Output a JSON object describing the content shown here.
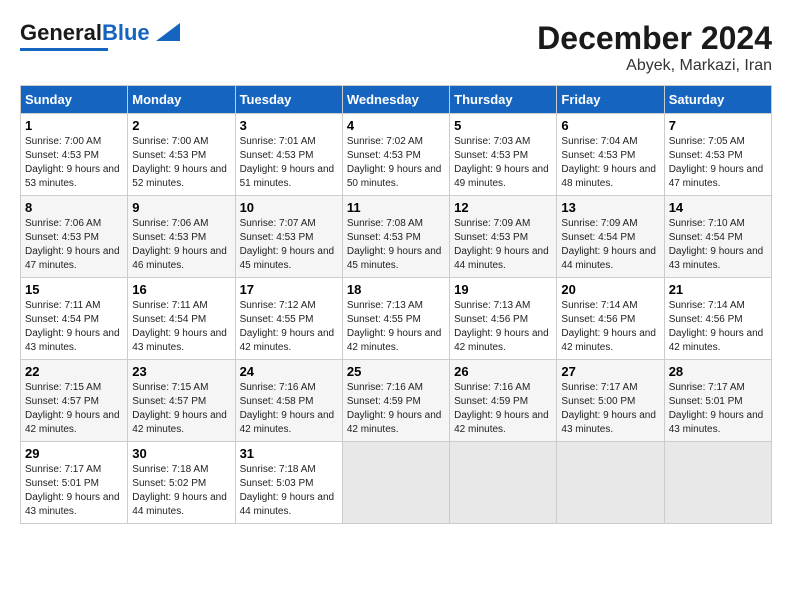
{
  "header": {
    "logo_general": "General",
    "logo_blue": "Blue",
    "month_title": "December 2024",
    "location": "Abyek, Markazi, Iran"
  },
  "calendar": {
    "days_of_week": [
      "Sunday",
      "Monday",
      "Tuesday",
      "Wednesday",
      "Thursday",
      "Friday",
      "Saturday"
    ],
    "weeks": [
      [
        {
          "day": "",
          "empty": true
        },
        {
          "day": "",
          "empty": true
        },
        {
          "day": "",
          "empty": true
        },
        {
          "day": "",
          "empty": true
        },
        {
          "day": "",
          "empty": true
        },
        {
          "day": "",
          "empty": true
        },
        {
          "day": "",
          "empty": true
        }
      ]
    ],
    "cells": [
      {
        "num": "1",
        "sunrise": "7:00 AM",
        "sunset": "4:53 PM",
        "daylight": "9 hours and 53 minutes."
      },
      {
        "num": "2",
        "sunrise": "7:00 AM",
        "sunset": "4:53 PM",
        "daylight": "9 hours and 52 minutes."
      },
      {
        "num": "3",
        "sunrise": "7:01 AM",
        "sunset": "4:53 PM",
        "daylight": "9 hours and 51 minutes."
      },
      {
        "num": "4",
        "sunrise": "7:02 AM",
        "sunset": "4:53 PM",
        "daylight": "9 hours and 50 minutes."
      },
      {
        "num": "5",
        "sunrise": "7:03 AM",
        "sunset": "4:53 PM",
        "daylight": "9 hours and 49 minutes."
      },
      {
        "num": "6",
        "sunrise": "7:04 AM",
        "sunset": "4:53 PM",
        "daylight": "9 hours and 48 minutes."
      },
      {
        "num": "7",
        "sunrise": "7:05 AM",
        "sunset": "4:53 PM",
        "daylight": "9 hours and 47 minutes."
      },
      {
        "num": "8",
        "sunrise": "7:06 AM",
        "sunset": "4:53 PM",
        "daylight": "9 hours and 47 minutes."
      },
      {
        "num": "9",
        "sunrise": "7:06 AM",
        "sunset": "4:53 PM",
        "daylight": "9 hours and 46 minutes."
      },
      {
        "num": "10",
        "sunrise": "7:07 AM",
        "sunset": "4:53 PM",
        "daylight": "9 hours and 45 minutes."
      },
      {
        "num": "11",
        "sunrise": "7:08 AM",
        "sunset": "4:53 PM",
        "daylight": "9 hours and 45 minutes."
      },
      {
        "num": "12",
        "sunrise": "7:09 AM",
        "sunset": "4:53 PM",
        "daylight": "9 hours and 44 minutes."
      },
      {
        "num": "13",
        "sunrise": "7:09 AM",
        "sunset": "4:54 PM",
        "daylight": "9 hours and 44 minutes."
      },
      {
        "num": "14",
        "sunrise": "7:10 AM",
        "sunset": "4:54 PM",
        "daylight": "9 hours and 43 minutes."
      },
      {
        "num": "15",
        "sunrise": "7:11 AM",
        "sunset": "4:54 PM",
        "daylight": "9 hours and 43 minutes."
      },
      {
        "num": "16",
        "sunrise": "7:11 AM",
        "sunset": "4:54 PM",
        "daylight": "9 hours and 43 minutes."
      },
      {
        "num": "17",
        "sunrise": "7:12 AM",
        "sunset": "4:55 PM",
        "daylight": "9 hours and 42 minutes."
      },
      {
        "num": "18",
        "sunrise": "7:13 AM",
        "sunset": "4:55 PM",
        "daylight": "9 hours and 42 minutes."
      },
      {
        "num": "19",
        "sunrise": "7:13 AM",
        "sunset": "4:56 PM",
        "daylight": "9 hours and 42 minutes."
      },
      {
        "num": "20",
        "sunrise": "7:14 AM",
        "sunset": "4:56 PM",
        "daylight": "9 hours and 42 minutes."
      },
      {
        "num": "21",
        "sunrise": "7:14 AM",
        "sunset": "4:56 PM",
        "daylight": "9 hours and 42 minutes."
      },
      {
        "num": "22",
        "sunrise": "7:15 AM",
        "sunset": "4:57 PM",
        "daylight": "9 hours and 42 minutes."
      },
      {
        "num": "23",
        "sunrise": "7:15 AM",
        "sunset": "4:57 PM",
        "daylight": "9 hours and 42 minutes."
      },
      {
        "num": "24",
        "sunrise": "7:16 AM",
        "sunset": "4:58 PM",
        "daylight": "9 hours and 42 minutes."
      },
      {
        "num": "25",
        "sunrise": "7:16 AM",
        "sunset": "4:59 PM",
        "daylight": "9 hours and 42 minutes."
      },
      {
        "num": "26",
        "sunrise": "7:16 AM",
        "sunset": "4:59 PM",
        "daylight": "9 hours and 42 minutes."
      },
      {
        "num": "27",
        "sunrise": "7:17 AM",
        "sunset": "5:00 PM",
        "daylight": "9 hours and 43 minutes."
      },
      {
        "num": "28",
        "sunrise": "7:17 AM",
        "sunset": "5:01 PM",
        "daylight": "9 hours and 43 minutes."
      },
      {
        "num": "29",
        "sunrise": "7:17 AM",
        "sunset": "5:01 PM",
        "daylight": "9 hours and 43 minutes."
      },
      {
        "num": "30",
        "sunrise": "7:18 AM",
        "sunset": "5:02 PM",
        "daylight": "9 hours and 44 minutes."
      },
      {
        "num": "31",
        "sunrise": "7:18 AM",
        "sunset": "5:03 PM",
        "daylight": "9 hours and 44 minutes."
      }
    ],
    "labels": {
      "sunrise": "Sunrise:",
      "sunset": "Sunset:",
      "daylight": "Daylight:"
    }
  }
}
